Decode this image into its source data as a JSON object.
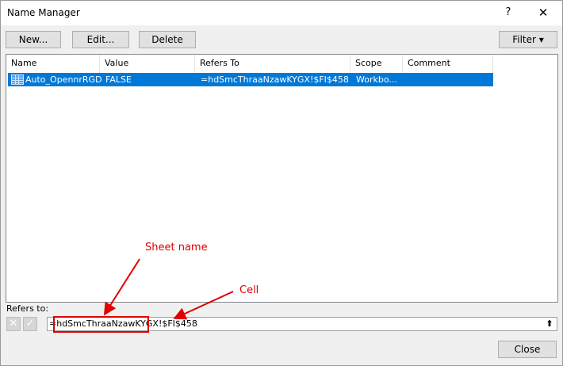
{
  "window": {
    "title": "Name Manager",
    "help": "?",
    "close": "✕"
  },
  "toolbar": {
    "new_label": "New...",
    "edit_label": "Edit...",
    "delete_label": "Delete",
    "filter_label": "Filter ▾"
  },
  "table": {
    "headers": [
      "Name",
      "Value",
      "Refers To",
      "Scope",
      "Comment"
    ],
    "rows": [
      {
        "name": "Auto_OpennrRGD",
        "value": "FALSE",
        "refers_to": "=hdSmcThraaNzawKYGX!$FI$458",
        "scope": "Workbo...",
        "comment": ""
      }
    ]
  },
  "refers": {
    "label": "Refers to:",
    "cancel_icon": "✕",
    "confirm_icon": "✓",
    "value": "=hdSmcThraaNzawKYGX!$FI$458",
    "collapse_icon": "⬆"
  },
  "annotations": {
    "sheet_name": "Sheet name",
    "cell": "Cell",
    "color": "#e00000"
  },
  "footer": {
    "close_label": "Close"
  }
}
